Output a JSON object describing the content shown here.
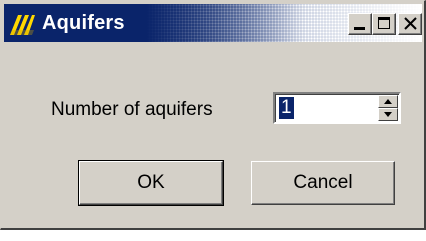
{
  "window": {
    "title": "Aquifers",
    "title_bar_color": "#0a246a",
    "face_color": "#d4d0c8",
    "controls": {
      "minimize_icon": "minimize-icon",
      "maximize_icon": "maximize-icon",
      "close_icon": "close-icon"
    }
  },
  "form": {
    "aquifers_label": "Number of aquifers",
    "aquifers_value": "1"
  },
  "buttons": {
    "ok_label": "OK",
    "cancel_label": "Cancel"
  }
}
